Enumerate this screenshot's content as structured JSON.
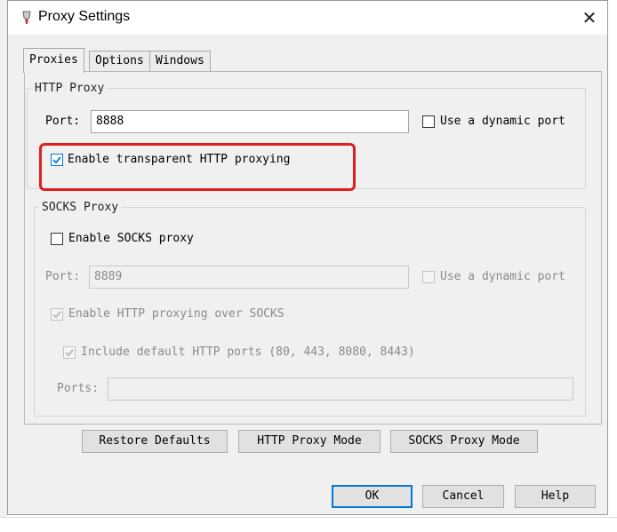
{
  "window": {
    "title": "Proxy Settings"
  },
  "tabs": [
    {
      "label": "Proxies"
    },
    {
      "label": "Options"
    },
    {
      "label": "Windows"
    }
  ],
  "http_proxy": {
    "legend": "HTTP Proxy",
    "port_label": "Port:",
    "port_value": "8888",
    "dynamic_port_label": "Use a dynamic port",
    "dynamic_port_checked": false,
    "transparent_label": "Enable transparent HTTP proxying",
    "transparent_checked": true
  },
  "socks_proxy": {
    "legend": "SOCKS Proxy",
    "enable_label": "Enable SOCKS proxy",
    "enable_checked": false,
    "port_label": "Port:",
    "port_value": "8889",
    "dynamic_port_label": "Use a dynamic port",
    "http_over_socks_label": "Enable HTTP proxying over SOCKS",
    "include_default_ports_label": "Include default HTTP ports (80, 443, 8080, 8443)",
    "ports_label": "Ports:",
    "ports_value": ""
  },
  "mode_buttons": {
    "restore": "Restore Defaults",
    "http_mode": "HTTP Proxy Mode",
    "socks_mode": "SOCKS Proxy Mode"
  },
  "footer": {
    "ok": "OK",
    "cancel": "Cancel",
    "help": "Help"
  },
  "colors": {
    "accent": "#0078d7",
    "highlight": "#e02020",
    "dialog_bg": "#f0f0f0"
  }
}
